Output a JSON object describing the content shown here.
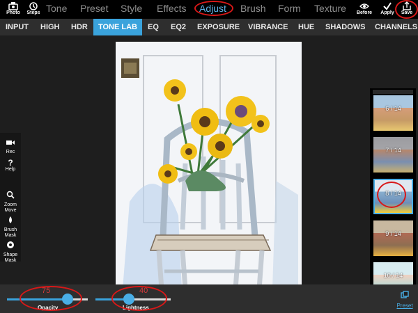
{
  "toolbar": {
    "photo_label": "Photo",
    "steps_label": "Steps",
    "before_label": "Before",
    "apply_label": "Apply",
    "save_label": "Save"
  },
  "menu": {
    "tone": "Tone",
    "preset": "Preset",
    "style": "Style",
    "effects": "Effects",
    "adjust": "Adjust",
    "brush": "Brush",
    "form": "Form",
    "texture": "Texture"
  },
  "subtabs": {
    "input": "INPUT",
    "high": "HIGH",
    "hdr": "HDR",
    "tone_lab": "TONE LAB",
    "eq": "EQ",
    "eq2": "EQ2",
    "exposure": "EXPOSURE",
    "vibrance": "VIBRANCE",
    "hue": "HUE",
    "shadows": "SHADOWS",
    "channels": "CHANNELS"
  },
  "side_tools": {
    "rec": "Rec",
    "help": "Help",
    "zoom_line1": "Zoom",
    "zoom_line2": "Move",
    "brush_line1": "Brush",
    "brush_line2": "Mask",
    "shape_line1": "Shape",
    "shape_line2": "Mask"
  },
  "presets": {
    "t5": "6 / 14",
    "t7": "7 / 14",
    "t8": "8 / 14",
    "t9": "9 / 14",
    "t10": "10 / 14",
    "selected_index": 8
  },
  "sliders": {
    "opacity": {
      "label": "Opacity",
      "value": "75",
      "level": 0.75
    },
    "lightness": {
      "label": "Lightness",
      "value": "40",
      "level": 0.4
    }
  },
  "preset_button_label": "Preset",
  "colors": {
    "accent": "#3aa3dc",
    "highlight_oval": "#d81818",
    "topbar_bg": "#000000",
    "subbar_bg": "#2e2e2e"
  }
}
